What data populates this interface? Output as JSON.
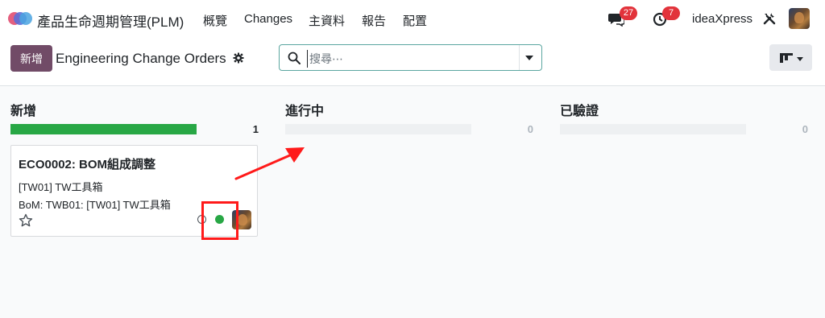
{
  "navbar": {
    "app_name": "產品生命週期管理(PLM)",
    "menu": [
      {
        "label": "概覽"
      },
      {
        "label": "Changes"
      },
      {
        "label": "主資料"
      },
      {
        "label": "報告"
      },
      {
        "label": "配置"
      }
    ],
    "messages_badge": "27",
    "activities_badge": "7",
    "company": "ideaXpress",
    "icons": [
      "app-logo-icon",
      "chat-icon",
      "clock-icon",
      "tools-icon",
      "avatar"
    ]
  },
  "control": {
    "new_button": "新增",
    "breadcrumb": "Engineering Change Orders",
    "search_placeholder": "搜尋⋯",
    "search_value": ""
  },
  "kanban": {
    "columns": [
      {
        "title": "新增",
        "count": "1",
        "progress": 1.0
      },
      {
        "title": "進行中",
        "count": "0",
        "progress": 0
      },
      {
        "title": "已驗證",
        "count": "0",
        "progress": 0
      }
    ],
    "card": {
      "title": "ECO0002: BOM組成調整",
      "product": "[TW01] TW工具箱",
      "bom": "BoM: TWB01: [TW01] TW工具箱",
      "starred": false,
      "status_color": "#28a745"
    }
  },
  "colors": {
    "brand": "#714b67",
    "badge": "#e2333b",
    "progress": "#28a745",
    "annotation": "#ff1a1a"
  }
}
